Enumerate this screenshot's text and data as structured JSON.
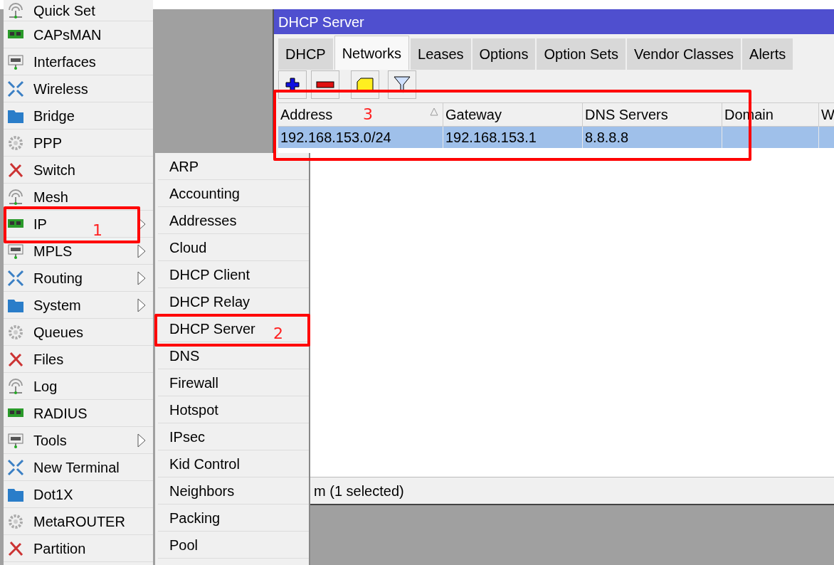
{
  "sidebar": {
    "items": [
      {
        "label": "Quick Set",
        "has_submenu": false
      },
      {
        "label": "CAPsMAN",
        "has_submenu": false
      },
      {
        "label": "Interfaces",
        "has_submenu": false
      },
      {
        "label": "Wireless",
        "has_submenu": false
      },
      {
        "label": "Bridge",
        "has_submenu": false
      },
      {
        "label": "PPP",
        "has_submenu": false
      },
      {
        "label": "Switch",
        "has_submenu": false
      },
      {
        "label": "Mesh",
        "has_submenu": false
      },
      {
        "label": "IP",
        "has_submenu": true
      },
      {
        "label": "MPLS",
        "has_submenu": true
      },
      {
        "label": "Routing",
        "has_submenu": true
      },
      {
        "label": "System",
        "has_submenu": true
      },
      {
        "label": "Queues",
        "has_submenu": false
      },
      {
        "label": "Files",
        "has_submenu": false
      },
      {
        "label": "Log",
        "has_submenu": false
      },
      {
        "label": "RADIUS",
        "has_submenu": false
      },
      {
        "label": "Tools",
        "has_submenu": true
      },
      {
        "label": "New Terminal",
        "has_submenu": false
      },
      {
        "label": "Dot1X",
        "has_submenu": false
      },
      {
        "label": "MetaROUTER",
        "has_submenu": false
      },
      {
        "label": "Partition",
        "has_submenu": false
      }
    ]
  },
  "submenu": {
    "items": [
      "ARP",
      "Accounting",
      "Addresses",
      "Cloud",
      "DHCP Client",
      "DHCP Relay",
      "DHCP Server",
      "DNS",
      "Firewall",
      "Hotspot",
      "IPsec",
      "Kid Control",
      "Neighbors",
      "Packing",
      "Pool"
    ]
  },
  "window": {
    "title": "DHCP Server",
    "tabs": [
      {
        "label": "DHCP",
        "selected": false
      },
      {
        "label": "Networks",
        "selected": true
      },
      {
        "label": "Leases",
        "selected": false
      },
      {
        "label": "Options",
        "selected": false
      },
      {
        "label": "Option Sets",
        "selected": false
      },
      {
        "label": "Vendor Classes",
        "selected": false
      },
      {
        "label": "Alerts",
        "selected": false
      }
    ],
    "table": {
      "columns": [
        {
          "label": "Address",
          "sorted": true
        },
        {
          "label": "Gateway",
          "sorted": false
        },
        {
          "label": "DNS Servers",
          "sorted": false
        },
        {
          "label": "Domain",
          "sorted": false
        },
        {
          "label": "W",
          "sorted": false
        }
      ],
      "rows": [
        {
          "selected": true,
          "cells": [
            "192.168.153.0/24",
            "192.168.153.1",
            "8.8.8.8",
            "",
            ""
          ]
        }
      ]
    },
    "status_bar": "m (1 selected)"
  },
  "annotations": [
    {
      "label": "1"
    },
    {
      "label": "2"
    },
    {
      "label": "3"
    }
  ]
}
